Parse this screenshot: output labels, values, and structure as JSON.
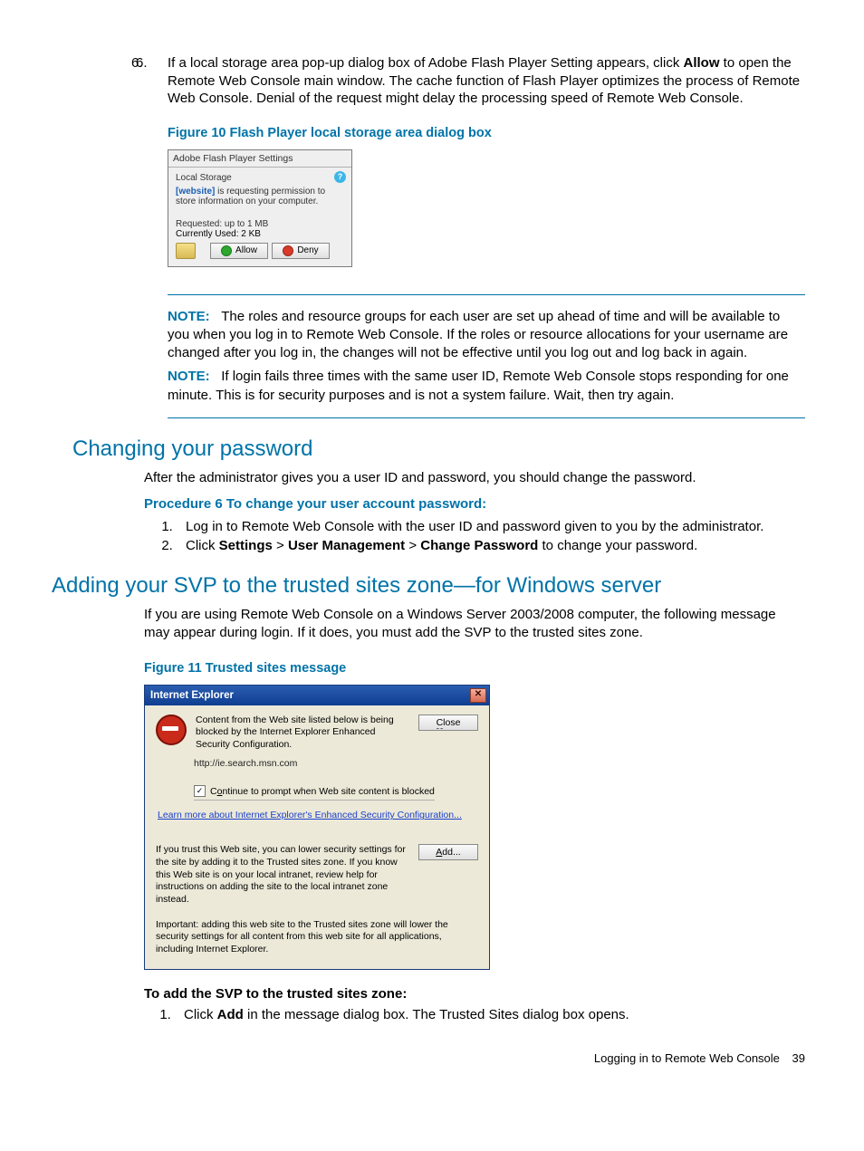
{
  "li6_prefix": "If a local storage area pop-up dialog box of Adobe Flash Player Setting appears, click ",
  "li6_allow": "Allow",
  "li6_rest": " to open the Remote Web Console main window. The cache function of Flash Player optimizes the process of Remote Web Console. Denial of the request might delay the processing speed of Remote Web Console.",
  "figure10_caption": "Figure 10 Flash Player local storage area dialog box",
  "flash": {
    "title": "Adobe Flash Player Settings",
    "local": "Local Storage",
    "website": "[website]",
    "msg_rest": " is requesting permission to store information on your computer.",
    "requested": "Requested: up to 1 MB",
    "used": "Currently Used: 2 KB",
    "allow": "Allow",
    "deny": "Deny"
  },
  "note_label": "NOTE:",
  "note1": "The roles and resource groups for each user are set up ahead of time and will be available to you when you log in to Remote Web Console. If the roles or resource allocations for your username are changed after you log in, the changes will not be effective until you log out and log back in again.",
  "note2": "If login fails three times with the same user ID, Remote Web Console stops responding for one minute. This is for security purposes and is not a system failure. Wait, then try again.",
  "h_changing": "Changing your password",
  "changing_body": "After the administrator gives you a user ID and password, you should change the password.",
  "proc_title": "Procedure 6 To change your user account password:",
  "proc6": {
    "s1": "Log in to Remote Web Console with the user ID and password given to you by the administrator.",
    "s2_a": "Click ",
    "s2_settings": "Settings",
    "s2_gt1": " > ",
    "s2_um": "User Management",
    "s2_gt2": " > ",
    "s2_cp": "Change Password",
    "s2_rest": " to change your password."
  },
  "h_adding": "Adding your SVP to the trusted sites zone—for Windows server",
  "adding_body": "If you are using Remote Web Console on a Windows Server 2003/2008 computer, the following message may appear during login. If it does, you must add the SVP to the trusted sites zone.",
  "figure11_caption": "Figure 11 Trusted sites message",
  "ie": {
    "title": "Internet Explorer",
    "msg": "Content from the Web site listed below is being blocked by the Internet Explorer Enhanced Security Configuration.",
    "close": "Close",
    "url": "http://ie.search.msn.com",
    "continue": "Continue to prompt when Web site content is blocked",
    "learn": "Learn more about Internet Explorer's Enhanced Security Configuration...",
    "trust": "If you trust this Web site, you can lower security settings for the site by adding it to the Trusted sites zone. If you know this Web site is on your local intranet, review help for instructions on adding the site to the local intranet zone instead.",
    "add": "Add...",
    "important": "Important: adding this web site to the Trusted sites zone will lower the security settings for all content from this web site for all applications, including Internet Explorer."
  },
  "add_svp_title": "To add the SVP to the trusted sites zone",
  "add_svp_colon": ":",
  "add_svp_step1_a": "Click ",
  "add_svp_step1_add": "Add",
  "add_svp_step1_rest": " in the message dialog box. The Trusted Sites dialog box opens.",
  "footer_text": "Logging in to Remote Web Console",
  "footer_page": "39"
}
